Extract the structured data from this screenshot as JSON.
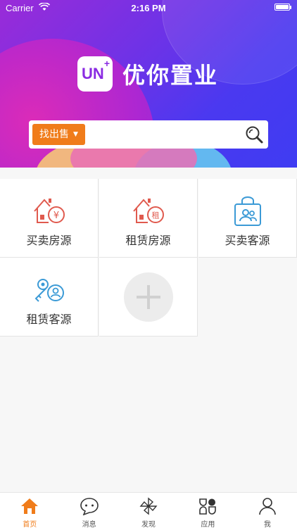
{
  "status": {
    "carrier": "Carrier",
    "time": "2:16 PM"
  },
  "brand": {
    "mark": "UN",
    "name": "优你置业"
  },
  "search": {
    "category": "找出售",
    "placeholder": ""
  },
  "tiles": [
    {
      "label": "买卖房源",
      "icon": "house-yuan-icon"
    },
    {
      "label": "租赁房源",
      "icon": "house-rent-icon"
    },
    {
      "label": "买卖客源",
      "icon": "bag-customers-icon"
    },
    {
      "label": "租赁客源",
      "icon": "key-person-icon"
    }
  ],
  "tabs": [
    {
      "label": "首页",
      "icon": "home-icon",
      "active": true
    },
    {
      "label": "消息",
      "icon": "chat-icon"
    },
    {
      "label": "发现",
      "icon": "pinwheel-icon"
    },
    {
      "label": "应用",
      "icon": "apps-icon"
    },
    {
      "label": "我",
      "icon": "person-icon"
    }
  ],
  "colors": {
    "accent": "#f07c1a",
    "icon_red": "#e05a4e",
    "icon_blue": "#3b9ad6"
  }
}
